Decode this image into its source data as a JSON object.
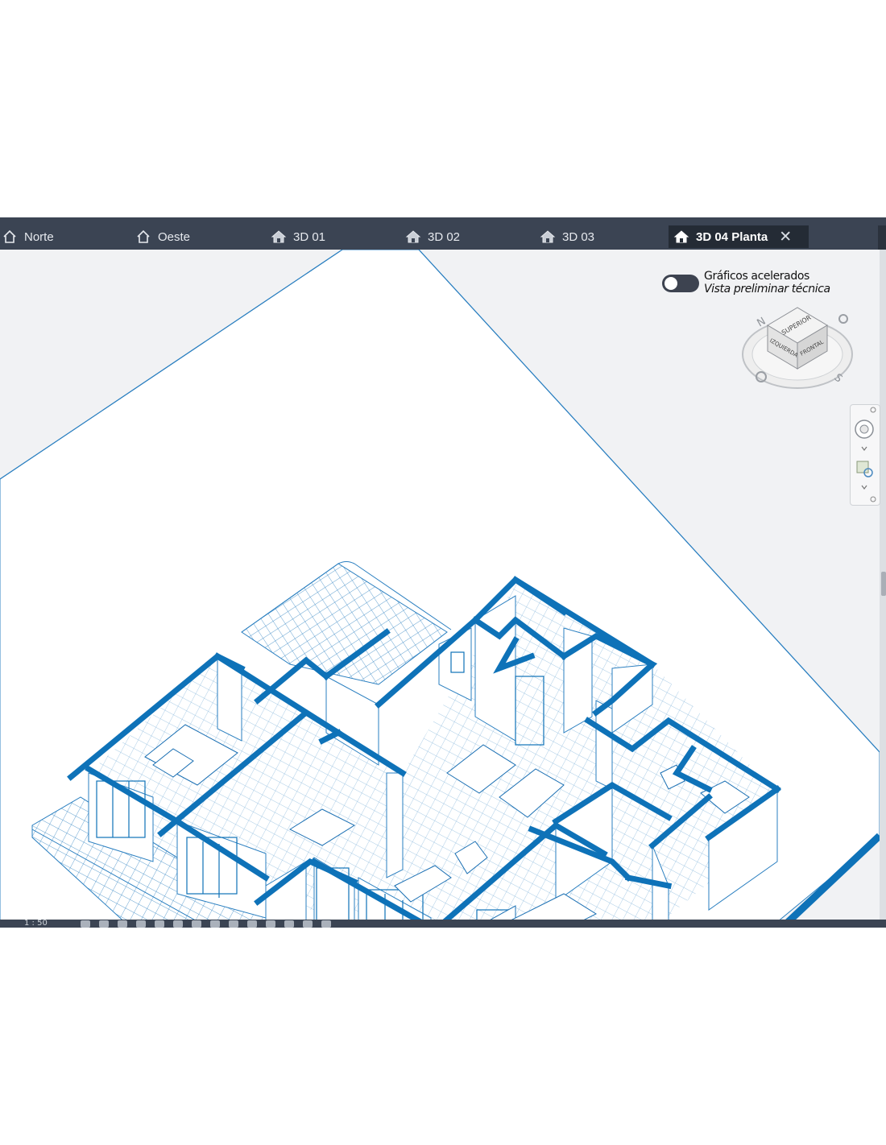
{
  "tabs": [
    {
      "label": "Norte",
      "icon": "elevation-view-icon"
    },
    {
      "label": "Oeste",
      "icon": "elevation-view-icon"
    },
    {
      "label": "3D 01",
      "icon": "3d-house-icon"
    },
    {
      "label": "3D 02",
      "icon": "3d-house-icon"
    },
    {
      "label": "3D 03",
      "icon": "3d-house-icon"
    },
    {
      "label": "3D 04 Planta",
      "icon": "3d-house-icon",
      "active": true
    }
  ],
  "overlay": {
    "line1": "Gráficos acelerados",
    "line2": "Vista preliminar técnica"
  },
  "viewcube": {
    "top": "SUPERIOR",
    "left": "IZQUIERDA",
    "front": "FRONTAL",
    "compass_n": "N",
    "compass_s": "S"
  },
  "statusbar": {
    "scale": "1 : 50"
  },
  "colors": {
    "drawing_line": "#1a6fb3",
    "wall": "#0e72b8",
    "tab_bar": "#3b4453",
    "active_tab": "#242b35"
  }
}
